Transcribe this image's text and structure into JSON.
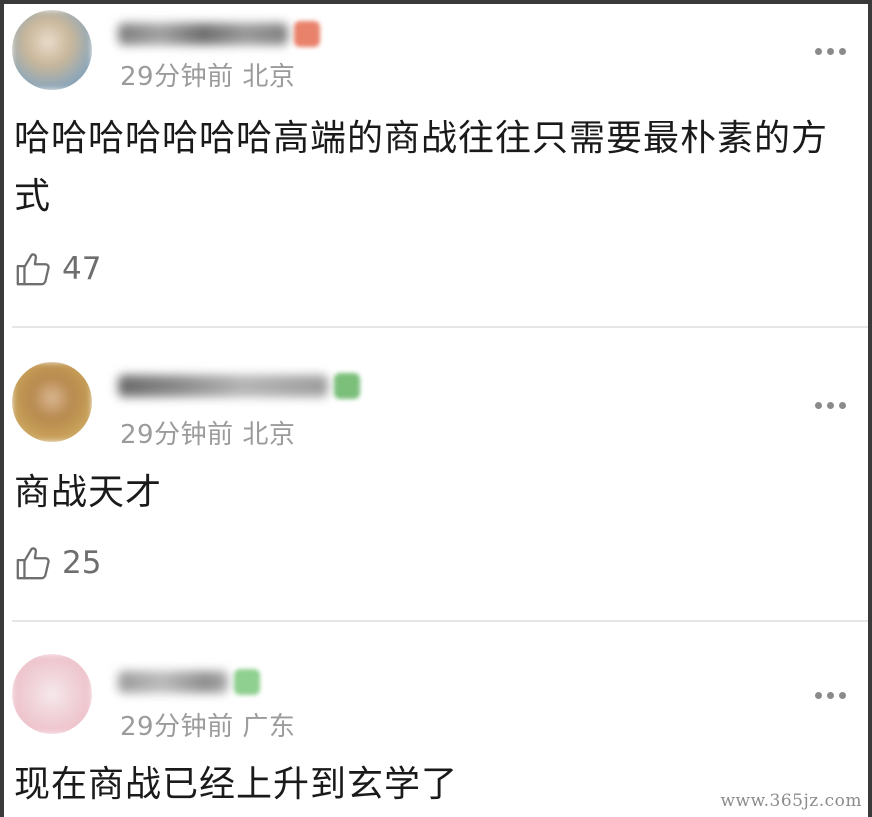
{
  "comments": [
    {
      "time": "29分钟前",
      "location": "北京",
      "text": "哈哈哈哈哈哈哈高端的商战往往只需要最朴素的方式",
      "likes": "47",
      "badge_color": "#e9826a"
    },
    {
      "time": "29分钟前",
      "location": "北京",
      "text": "商战天才",
      "likes": "25",
      "badge_color": "#7bbf7b"
    },
    {
      "time": "29分钟前",
      "location": "广东",
      "text": "现在商战已经上升到玄学了",
      "badge_color": "#8fcf8f"
    }
  ],
  "icons": {
    "like": "thumbs-up-icon",
    "more": "more-dots-icon"
  },
  "watermark": "www.365jz.com"
}
